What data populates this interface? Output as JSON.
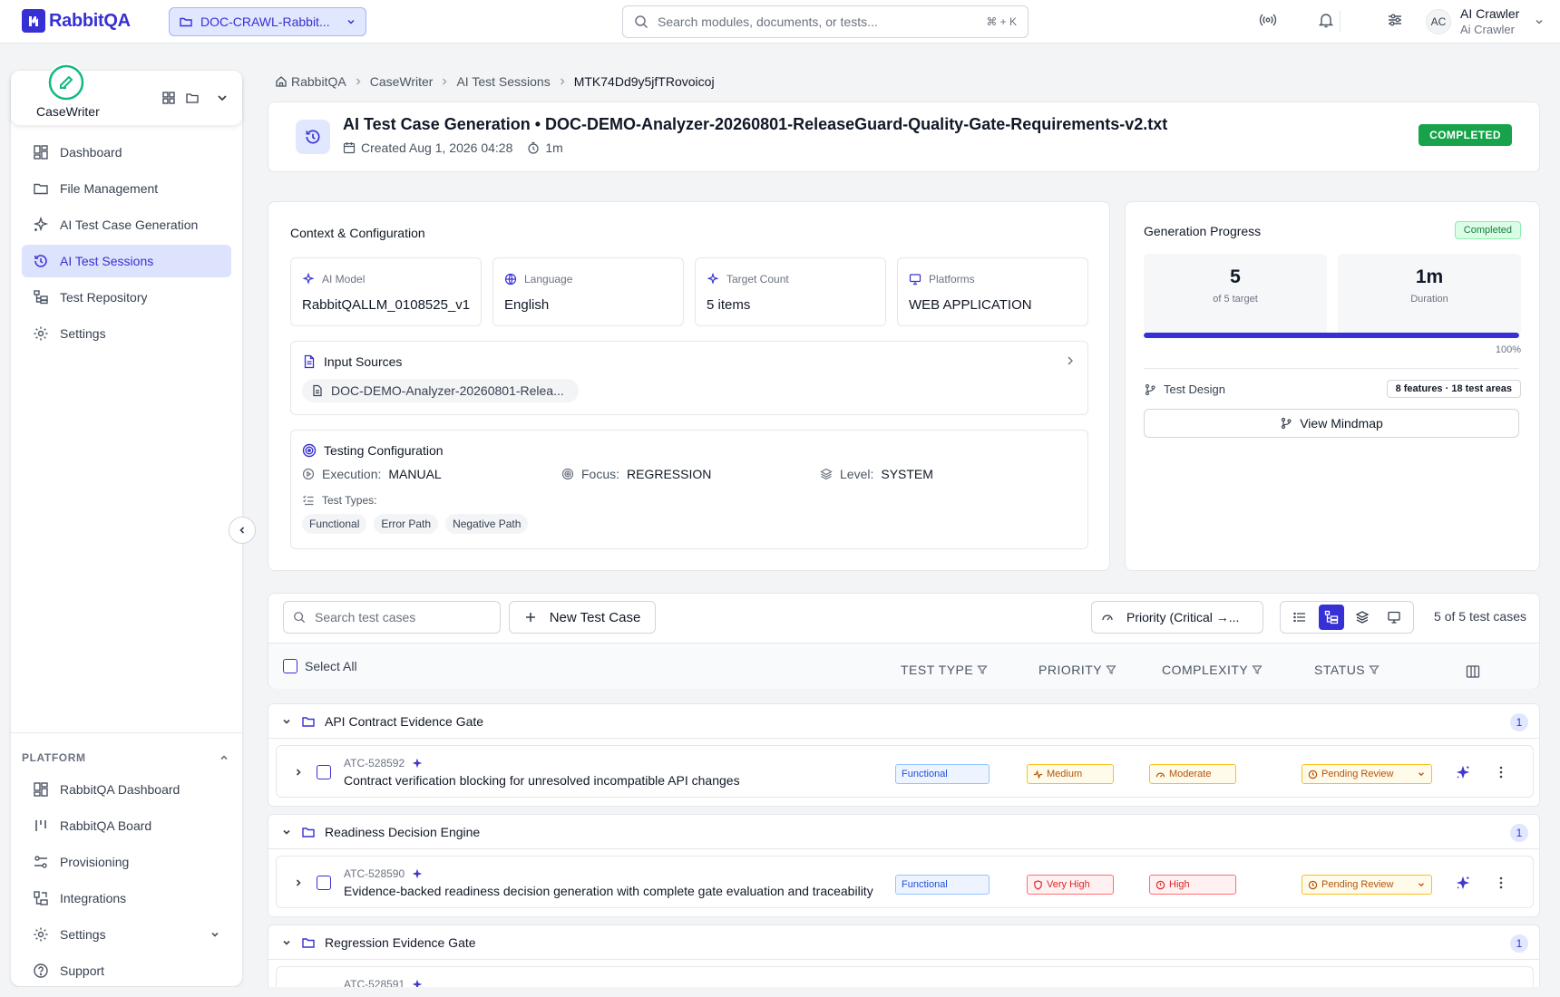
{
  "app": {
    "logo_text": "RabbitQA",
    "brand_color": "#3730d4"
  },
  "topbar": {
    "project": "DOC-CRAWL-Rabbit...",
    "search_placeholder": "Search modules, documents, or tests...",
    "search_shortcut": "⌘ + K",
    "user_initials": "AC",
    "user_name": "AI Crawler",
    "user_sub": "Ai Crawler"
  },
  "sidebar": {
    "app_name": "CaseWriter",
    "items": [
      {
        "label": "Dashboard",
        "icon": "dashboard-icon"
      },
      {
        "label": "File Management",
        "icon": "folder-icon"
      },
      {
        "label": "AI Test Case Generation",
        "icon": "sparkles-icon"
      },
      {
        "label": "AI Test Sessions",
        "icon": "history-icon",
        "active": true
      },
      {
        "label": "Test Repository",
        "icon": "tree-icon"
      },
      {
        "label": "Settings",
        "icon": "gear-icon"
      }
    ],
    "platform_label": "PLATFORM",
    "platform_items": [
      {
        "label": "RabbitQA Dashboard",
        "icon": "dashboard-icon"
      },
      {
        "label": "RabbitQA Board",
        "icon": "board-icon"
      },
      {
        "label": "Provisioning",
        "icon": "provisioning-icon"
      },
      {
        "label": "Integrations",
        "icon": "integrations-icon"
      },
      {
        "label": "Settings",
        "icon": "gear-icon"
      },
      {
        "label": "Support",
        "icon": "help-icon"
      }
    ]
  },
  "breadcrumb": [
    "RabbitQA",
    "CaseWriter",
    "AI Test Sessions",
    "MTK74Dd9y5jfTRovoicoj"
  ],
  "session": {
    "title": "AI Test Case Generation • DOC-DEMO-Analyzer-20260801-ReleaseGuard-Quality-Gate-Requirements-v2.txt",
    "created": "Created Aug 1, 2026 04:28",
    "duration": "1m",
    "status": "COMPLETED"
  },
  "context": {
    "title": "Context & Configuration",
    "ai_model_label": "AI Model",
    "ai_model": "RabbitQALLM_0108525_v1",
    "language_label": "Language",
    "language": "English",
    "target_label": "Target Count",
    "target": "5 items",
    "platforms_label": "Platforms",
    "platforms": "WEB APPLICATION",
    "input_sources_title": "Input Sources",
    "input_source_file": "DOC-DEMO-Analyzer-20260801-Relea...",
    "testing_config_title": "Testing Configuration",
    "execution_label": "Execution:",
    "execution": "MANUAL",
    "focus_label": "Focus:",
    "focus": "REGRESSION",
    "level_label": "Level:",
    "level": "SYSTEM",
    "test_types_label": "Test Types:",
    "test_types": [
      "Functional",
      "Error Path",
      "Negative Path"
    ]
  },
  "progress": {
    "title": "Generation Progress",
    "badge": "Completed",
    "generated": "5",
    "generated_sub": "of 5 target",
    "duration": "1m",
    "duration_sub": "Duration",
    "percent_label": "100%",
    "percent": 100,
    "test_design_label": "Test Design",
    "test_design_badge": "8 features · 18 test areas",
    "view_mindmap": "View Mindmap"
  },
  "toolbar": {
    "search_placeholder": "Search test cases",
    "new_test_case": "New Test Case",
    "sort": "Priority (Critical →...",
    "result_count": "5 of 5 test cases",
    "select_all": "Select All",
    "col_test_type": "TEST TYPE",
    "col_priority": "PRIORITY",
    "col_complexity": "COMPLEXITY",
    "col_status": "STATUS"
  },
  "groups": [
    {
      "name": "API Contract Evidence Gate",
      "count": "1",
      "case": {
        "id": "ATC-528592",
        "title": "Contract verification blocking for unresolved incompatible API changes",
        "type": "Functional",
        "priority": "Medium",
        "complexity": "Moderate",
        "status": "Pending Review"
      }
    },
    {
      "name": "Readiness Decision Engine",
      "count": "1",
      "case": {
        "id": "ATC-528590",
        "title": "Evidence-backed readiness decision generation with complete gate evaluation and traceability",
        "type": "Functional",
        "priority": "Very High",
        "complexity": "High",
        "status": "Pending Review"
      }
    },
    {
      "name": "Regression Evidence Gate",
      "count": "1",
      "case": {
        "id": "ATC-528591"
      }
    }
  ]
}
